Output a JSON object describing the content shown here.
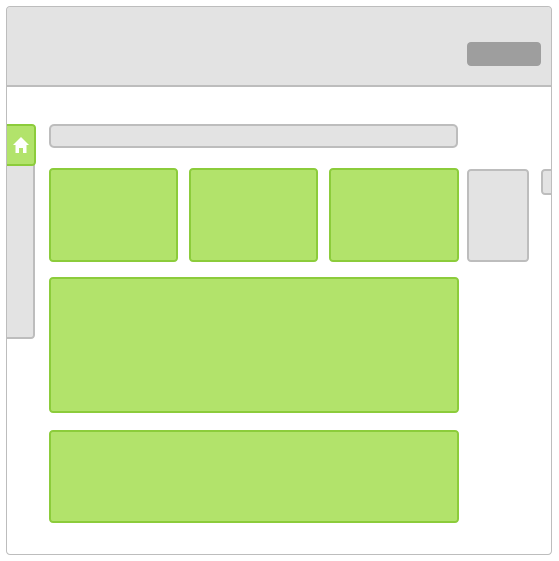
{
  "window": {
    "title_bar_button_label": ""
  },
  "address_bar": {
    "value": ""
  },
  "sidebar": {
    "home_icon": "home-icon"
  },
  "colors": {
    "accent_green": "#b2e36b",
    "accent_green_border": "#8ccc3b",
    "panel_grey": "#e3e3e3",
    "border_grey": "#bdbdbd",
    "button_grey": "#9e9e9e"
  }
}
